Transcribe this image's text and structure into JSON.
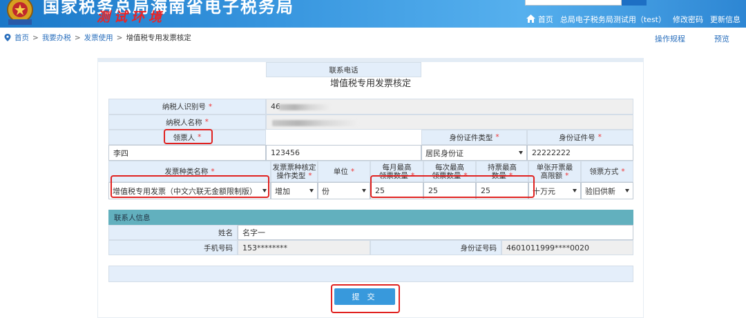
{
  "header": {
    "title": "国家税务总局海南省电子税务局",
    "test_tag": "测试环境",
    "search_placeholder": "",
    "search_button": "",
    "top_links": "",
    "nav": {
      "home": "首页",
      "user": "总局电子税务局测试用（test）",
      "change_password": "修改密码",
      "update_info": "更新信息"
    }
  },
  "breadcrumb": {
    "home": "首页",
    "level1": "我要办税",
    "level2": "发票使用",
    "current": "增值税专用发票核定"
  },
  "actions": {
    "guide": "操作规程",
    "preview": "预览"
  },
  "form": {
    "title": "增值税专用发票核定",
    "taxpayer_id_label": "纳税人识别号",
    "taxpayer_id_value": "46",
    "taxpayer_name_label": "纳税人名称",
    "required_mark": "*",
    "receiver": {
      "label": "领票人",
      "phone_label": "联系电话",
      "id_type_label": "身份证件类型",
      "id_no_label": "身份证件号",
      "name": "李四",
      "phone": "123456",
      "id_type": "居民身份证",
      "id_no": "22222222"
    },
    "invoice_headers": {
      "type_name": "发票种类名称",
      "op_type_1": "发票票种核定",
      "op_type_2": "操作类型",
      "unit": "单位",
      "monthly_1": "每月最高",
      "monthly_2": "领票数量",
      "each_1": "每次最高",
      "each_2": "领票数量",
      "hold_1": "持票最高",
      "hold_2": "数量",
      "limit_1": "单张开票最",
      "limit_2": "高限额",
      "method": "领票方式"
    },
    "invoice_row": {
      "type_name": "增值税专用发票（中文六联无金额限制版）",
      "op_type": "增加",
      "unit": "份",
      "monthly": "25",
      "each": "25",
      "hold": "25",
      "limit": "十万元",
      "method": "验旧供新"
    },
    "contact": {
      "section_label": "联系人信息",
      "name_label": "姓名",
      "name_value": "名字一",
      "mobile_label": "手机号码",
      "mobile_value": "153********",
      "id_label": "身份证号码",
      "id_value": "4601011999****0020"
    },
    "submit": "提 交"
  },
  "colors": {
    "header_blue": "#3a98e0",
    "label_bg": "#e3eefa",
    "section_teal": "#62b0be",
    "submit_blue": "#3899dc",
    "highlight_red": "#e0211f"
  }
}
